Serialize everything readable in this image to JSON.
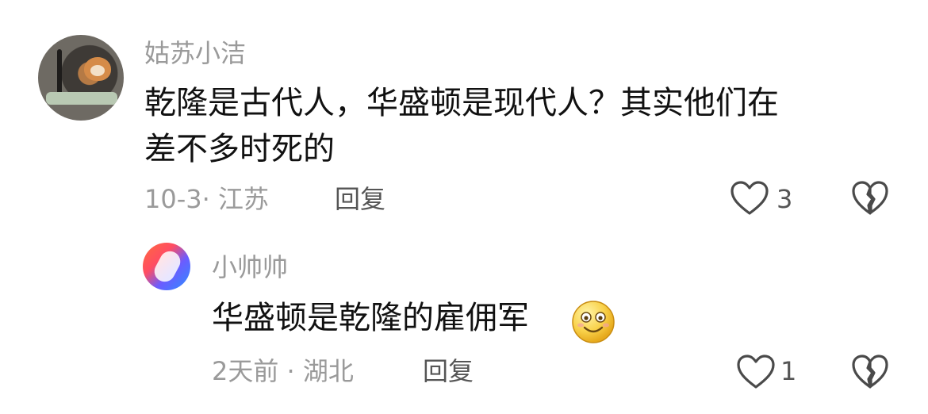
{
  "comment": {
    "username": "姑苏小洁",
    "text_line1": "乾隆是古代人，华盛顿是现代人？其实他们在",
    "text_line2": "差不多时死的",
    "date_location": "10-3· 江苏",
    "reply_label": "回复",
    "like_count": "3"
  },
  "reply": {
    "username": "小帅帅",
    "text": "华盛顿是乾隆的雇佣军",
    "date_location": "2天前 · 湖北",
    "reply_label": "回复",
    "like_count": "1"
  },
  "icons": {
    "like": "heart-outline",
    "dislike": "broken-heart-outline",
    "emoji": "smiling-face"
  }
}
